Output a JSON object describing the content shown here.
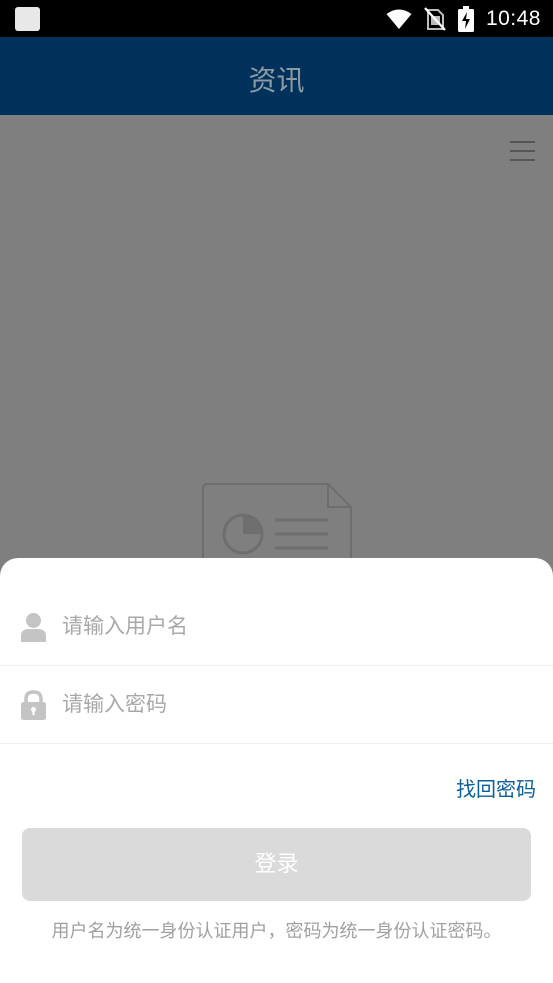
{
  "status_bar": {
    "time": "10:48",
    "icons": [
      "app-notification-icon",
      "wifi-icon",
      "no-sim-icon",
      "battery-charging-icon"
    ]
  },
  "header": {
    "title": "资讯"
  },
  "content": {
    "menu_icon": "hamburger-menu-icon",
    "empty_state_icon": "document-chart-icon"
  },
  "login_sheet": {
    "username": {
      "icon": "user-icon",
      "placeholder": "请输入用户名",
      "value": ""
    },
    "password": {
      "icon": "lock-icon",
      "placeholder": "请输入密码",
      "value": ""
    },
    "forgot_password_label": "找回密码",
    "login_label": "登录",
    "hint": "用户名为统一身份认证用户，密码为统一身份认证密码。"
  },
  "colors": {
    "header_bg": "#00315a",
    "overlay_bg": "#7f7f7f",
    "link": "#0b5f9c",
    "button_disabled": "#dadada"
  }
}
